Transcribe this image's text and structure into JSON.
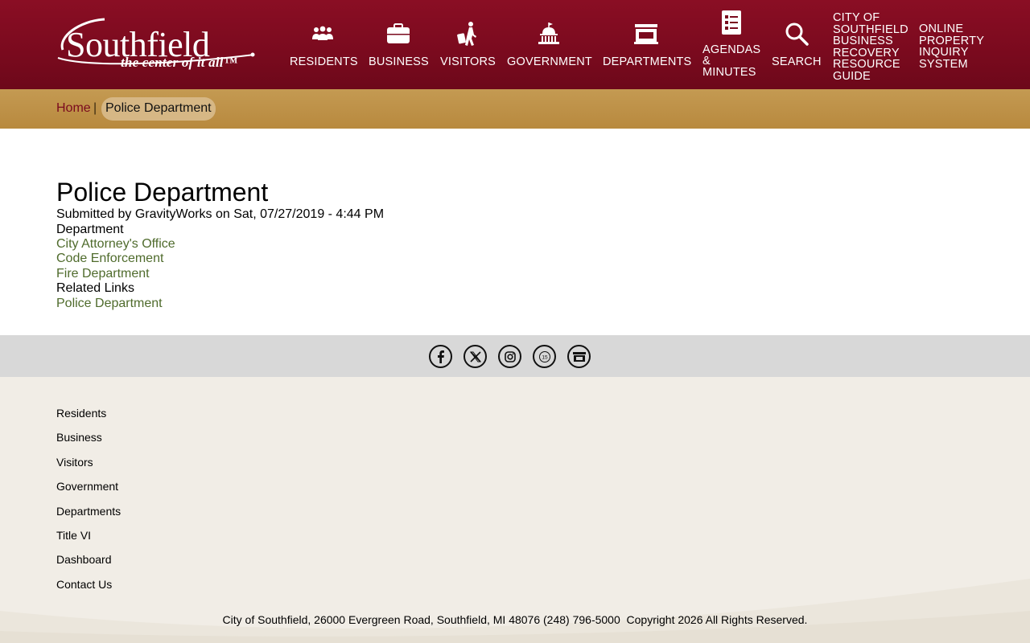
{
  "header": {
    "logo_word": "Southfield",
    "logo_tagline": "the center of it all™",
    "nav": [
      {
        "label": "RESIDENTS",
        "icon": "people-icon"
      },
      {
        "label": "BUSINESS",
        "icon": "briefcase-icon"
      },
      {
        "label": "VISITORS",
        "icon": "traveler-icon"
      },
      {
        "label": "GOVERNMENT",
        "icon": "capitol-icon"
      },
      {
        "label": "DEPARTMENTS",
        "icon": "storefront-icon"
      },
      {
        "label": "AGENDAS & MINUTES",
        "line1": "AGENDAS",
        "line2": "&",
        "line3": "MINUTES",
        "icon": "document-list-icon"
      },
      {
        "label": "SEARCH",
        "icon": "search-icon"
      }
    ],
    "recovery_lines": [
      "CITY OF",
      "SOUTHFIELD",
      "BUSINESS",
      "RECOVERY",
      "RESOURCE",
      "GUIDE"
    ],
    "property_lines": [
      "ONLINE",
      "PROPERTY",
      "INQUIRY",
      "SYSTEM"
    ]
  },
  "breadcrumb": {
    "home": "Home",
    "separator": "|",
    "current": "Police Department"
  },
  "main": {
    "title": "Police Department",
    "submitted": "Submitted by GravityWorks on Sat, 07/27/2019 - 4:44 PM",
    "department_label": "Department",
    "department_links": [
      "City Attorney's Office",
      "Code Enforcement",
      "Fire Department"
    ],
    "related_label": "Related Links",
    "related_links": [
      "Police Department"
    ]
  },
  "social": [
    "facebook-icon",
    "x-icon",
    "instagram-icon",
    "cable-channel-icon",
    "storefront-icon"
  ],
  "footer": {
    "links": [
      "Residents",
      "Business",
      "Visitors",
      "Government",
      "Departments",
      "Title VI",
      "Dashboard",
      "Contact Us"
    ],
    "copyright": "City of Southfield, 26000 Evergreen Road, Southfield, MI 48076 (248) 796-5000  Copyright 2026 All Rights Reserved."
  },
  "colors": {
    "header": "#7a0a1e",
    "breadcrumb_bar": "#b8893e",
    "link_green": "#4f6b2c",
    "social_bar": "#d8d8d8",
    "footer_bg": "#f1ede6"
  }
}
